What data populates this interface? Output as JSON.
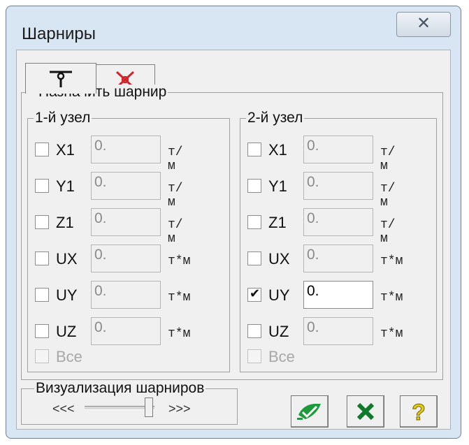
{
  "window": {
    "title": "Шарниры",
    "close": "✕"
  },
  "tabs": [
    {
      "icon": "hinge-icon",
      "active": true
    },
    {
      "icon": "cut-hinge-icon",
      "active": false
    }
  ],
  "assign": {
    "legend": "Назначить шарнир",
    "node1": {
      "legend": "1-й узел",
      "rows": [
        {
          "label": "X1",
          "value": "0.",
          "unit": "т/м",
          "checked": false
        },
        {
          "label": "Y1",
          "value": "0.",
          "unit": "т/м",
          "checked": false
        },
        {
          "label": "Z1",
          "value": "0.",
          "unit": "т/м",
          "checked": false
        },
        {
          "label": "UX",
          "value": "0.",
          "unit": "т*м",
          "checked": false
        },
        {
          "label": "UY",
          "value": "0.",
          "unit": "т*м",
          "checked": false
        },
        {
          "label": "UZ",
          "value": "0.",
          "unit": "т*м",
          "checked": false
        }
      ],
      "all": "Все"
    },
    "node2": {
      "legend": "2-й узел",
      "rows": [
        {
          "label": "X1",
          "value": "0.",
          "unit": "т/м",
          "checked": false
        },
        {
          "label": "Y1",
          "value": "0.",
          "unit": "т/м",
          "checked": false
        },
        {
          "label": "Z1",
          "value": "0.",
          "unit": "т/м",
          "checked": false
        },
        {
          "label": "UX",
          "value": "0.",
          "unit": "т*м",
          "checked": false
        },
        {
          "label": "UY",
          "value": "0.",
          "unit": "т*м",
          "checked": true
        },
        {
          "label": "UZ",
          "value": "0.",
          "unit": "т*м",
          "checked": false
        }
      ],
      "all": "Все"
    }
  },
  "visualization": {
    "legend": "Визуализация шарниров",
    "left": "<<<",
    "right": ">>>"
  },
  "buttons": {
    "ok_icon": "apply-icon",
    "cancel_icon": "cancel-icon",
    "help_icon": "help-icon",
    "help_text": "?"
  },
  "colors": {
    "accent_green": "#1f9a3a",
    "cancel_green": "#0f7a2a",
    "help_yellow": "#e8d000",
    "tab_red": "#d2232a"
  }
}
